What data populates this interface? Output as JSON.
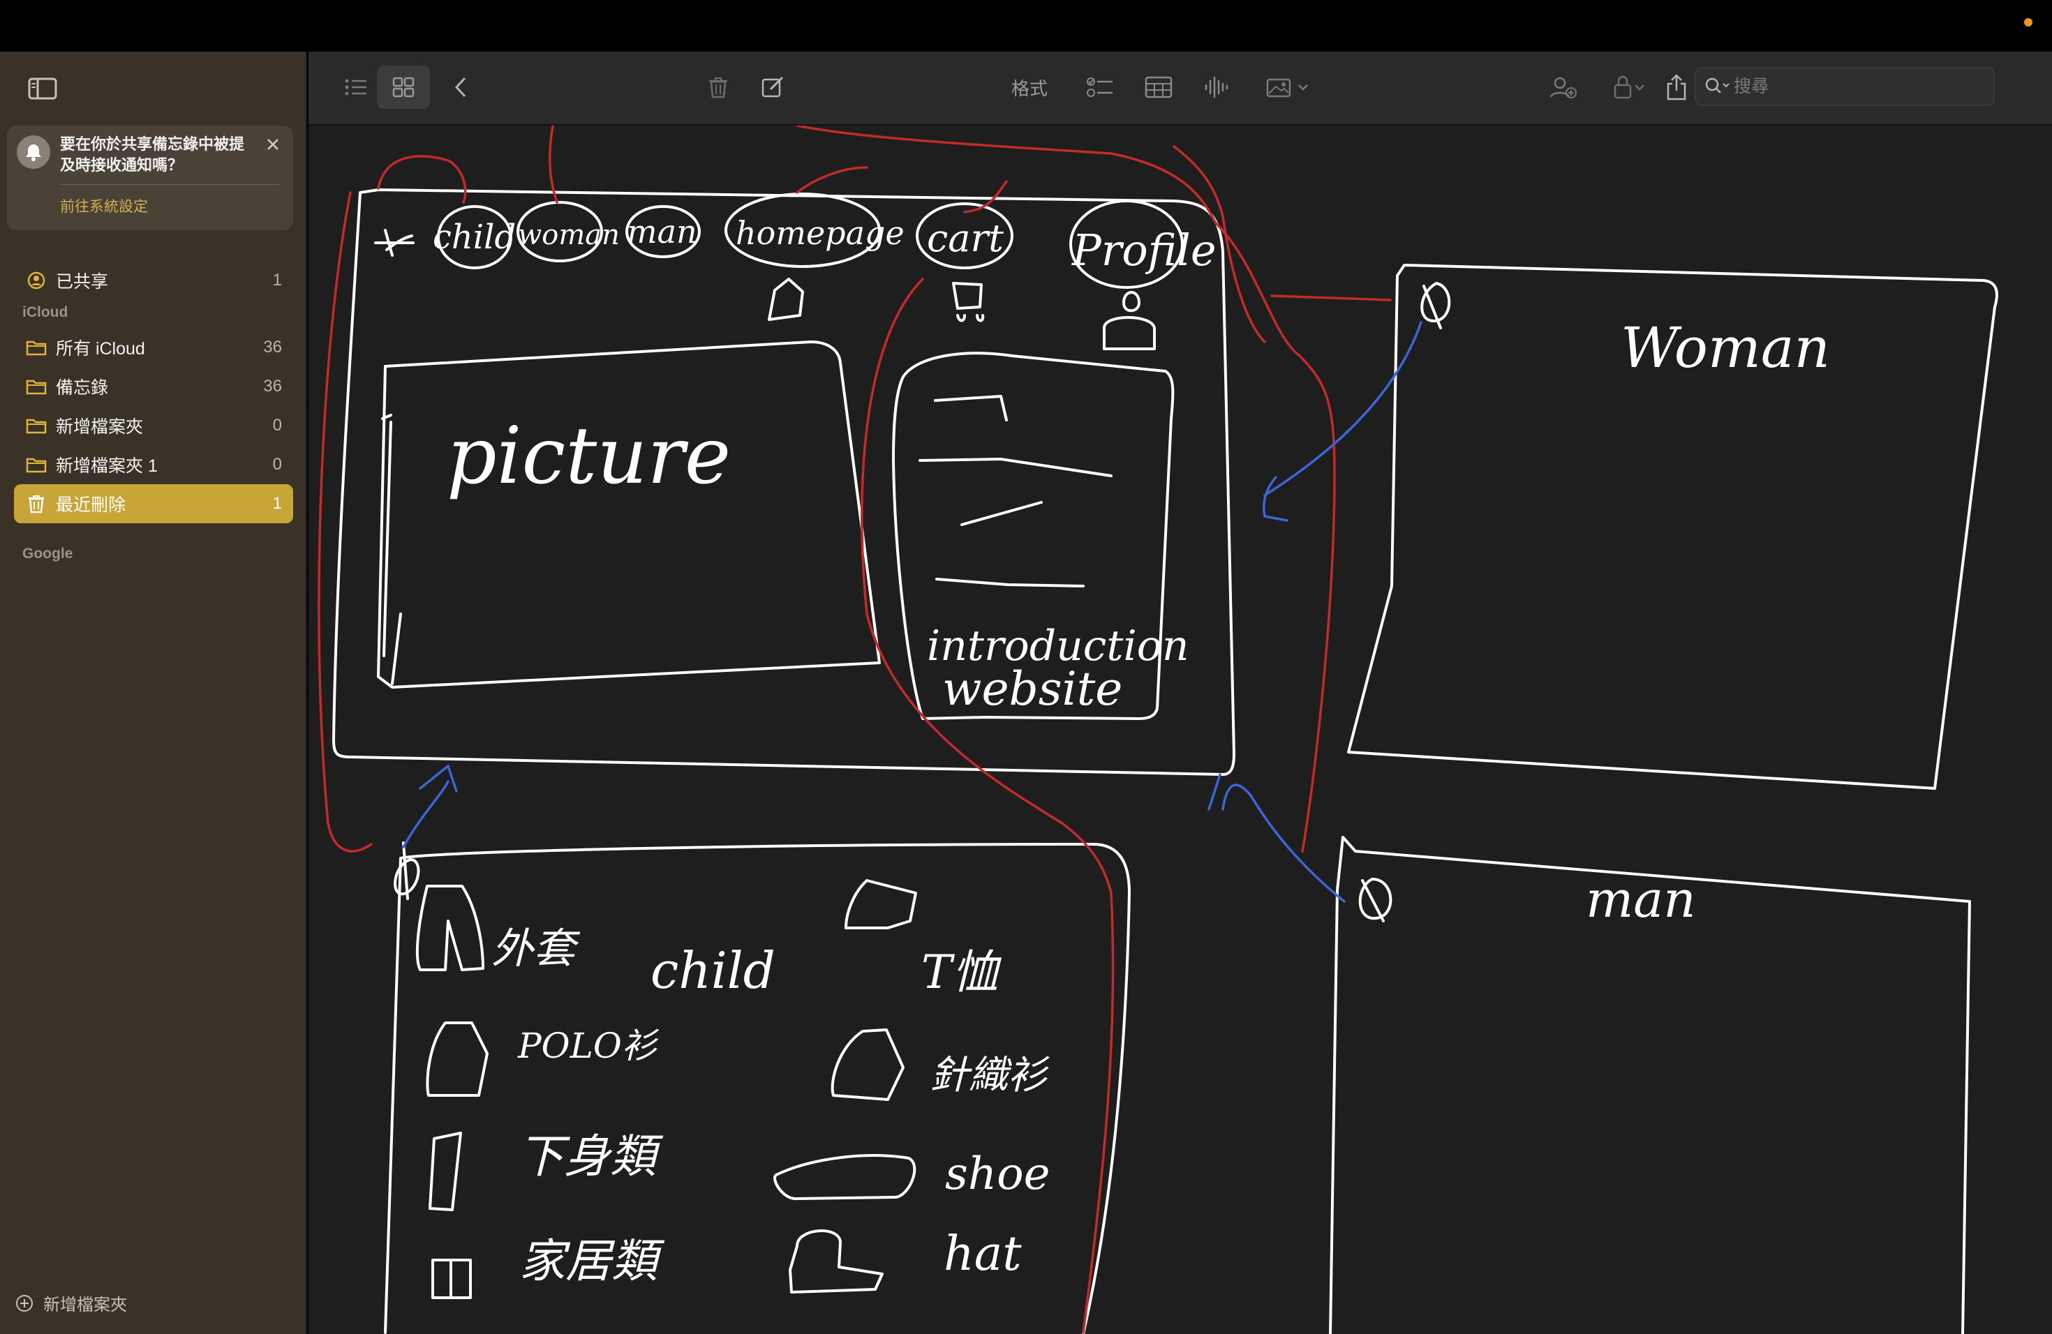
{
  "sidebar": {
    "notice": {
      "message": "要在你於共享備忘錄中被提及時接收通知嗎？",
      "link": "前往系統設定"
    },
    "shared": {
      "label": "已共享",
      "count": "1"
    },
    "sections": {
      "icloud": "iCloud",
      "google": "Google"
    },
    "folders": [
      {
        "label": "所有 iCloud",
        "count": "36"
      },
      {
        "label": "備忘錄",
        "count": "36"
      },
      {
        "label": "新增檔案夾",
        "count": "0"
      },
      {
        "label": "新增檔案夾 1",
        "count": "0"
      }
    ],
    "recently_deleted": {
      "label": "最近刪除",
      "count": "1"
    },
    "footer": {
      "label": "新增檔案夾"
    }
  },
  "toolbar": {
    "format_label": "格式",
    "search_placeholder": "搜尋"
  },
  "sketch": {
    "labels": [
      "child",
      "woman",
      "man",
      "homepage",
      "cart",
      "Profile",
      "picture",
      "introduction",
      "website",
      "Woman",
      "man",
      "外套",
      "child",
      "T恤",
      "POLO衫",
      "針織衫",
      "下身類",
      "shoe",
      "家居類",
      "hat"
    ]
  },
  "colors": {
    "accent": "#c9a436",
    "sidebar_bg": "#3a3127",
    "canvas_bg": "#1e1e1e",
    "ink_white": "#ffffff",
    "ink_red": "#c42a2a",
    "ink_blue": "#3a66d6"
  }
}
